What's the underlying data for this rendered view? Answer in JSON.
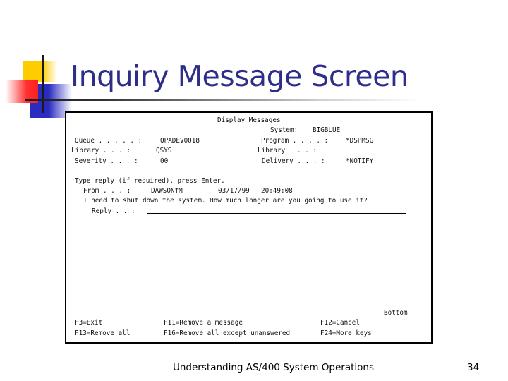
{
  "slide": {
    "title": "Inquiry Message Screen",
    "footer": "Understanding AS/400 System Operations",
    "page_number": "34",
    "colors": {
      "title": "#2e2e8a",
      "accent_yellow": "#ffcc00",
      "accent_red": "#ff2020",
      "accent_blue": "#2b2bc0"
    }
  },
  "terminal": {
    "heading": "Display Messages",
    "system_label": "System:",
    "system_value": "BIGBLUE",
    "left_fields": [
      {
        "label": "Queue . . . . . :",
        "value": "QPADEV0018"
      },
      {
        "label": "Library . . . :",
        "value": "QSYS"
      },
      {
        "label": "Severity . . . :",
        "value": "00"
      }
    ],
    "right_fields": [
      {
        "label": "Program . . . . :",
        "value": "*DSPMSG"
      },
      {
        "label": "Library . . . :",
        "value": ""
      },
      {
        "label": "Delivery . . . :",
        "value": "*NOTIFY"
      }
    ],
    "instruction": "Type reply (if required), press Enter.",
    "from_label": "From . . . :",
    "from_user": "DAWSON†M",
    "from_date": "03/17/99",
    "from_time": "20:49:08",
    "message": "I need to shut down the system. How much longer are you going to use it?",
    "reply_label": "Reply . . :",
    "reply_value": "",
    "scroll_status": "Bottom",
    "function_keys": [
      {
        "label": "F3=Exit"
      },
      {
        "label": "F11=Remove a message"
      },
      {
        "label": "F12=Cancel"
      },
      {
        "label": "F13=Remove all"
      },
      {
        "label": "F16=Remove all except unanswered"
      },
      {
        "label": "F24=More keys"
      }
    ]
  }
}
